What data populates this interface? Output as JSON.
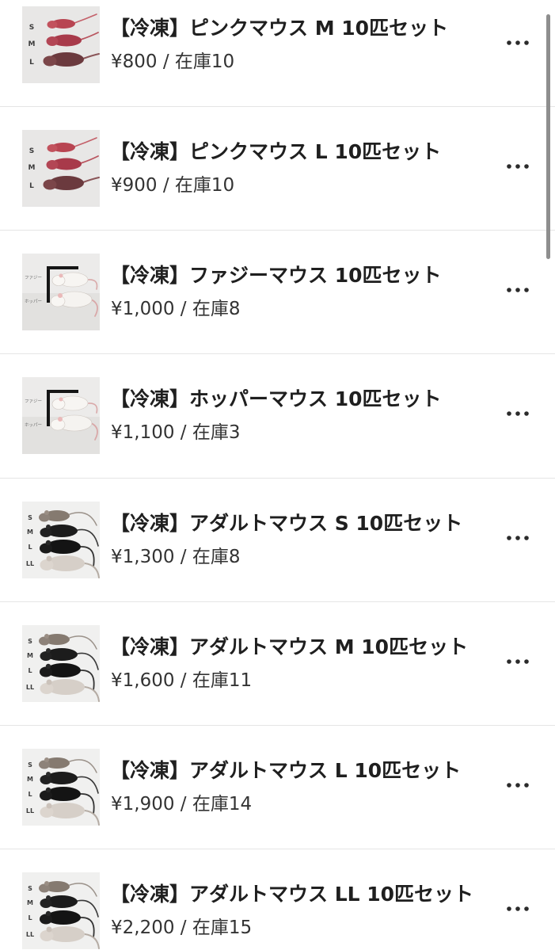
{
  "separator": " / ",
  "icons": {
    "row_menu_icon": "more-horizontal-icon"
  },
  "colors": {
    "background": "#ffffff",
    "title_text": "#1f1f1f",
    "price_text": "#333333",
    "divider": "#e5e5e5",
    "menu_icon": "#2b2b2b",
    "scrollbar": "#8e8e8e"
  },
  "products": [
    {
      "title": "【冷凍】ピンクマウス M 10匹セット",
      "price": "¥800",
      "stock": "在庫10",
      "thumbnail": {
        "labels": [
          "S",
          "M",
          "L"
        ]
      }
    },
    {
      "title": "【冷凍】ピンクマウス L 10匹セット",
      "price": "¥900",
      "stock": "在庫10",
      "thumbnail": {
        "labels": [
          "S",
          "M",
          "L"
        ]
      }
    },
    {
      "title": "【冷凍】ファジーマウス 10匹セット",
      "price": "¥1,000",
      "stock": "在庫8",
      "thumbnail": {
        "labels": [
          "ファジー",
          "ホッパー"
        ]
      }
    },
    {
      "title": "【冷凍】ホッパーマウス 10匹セット",
      "price": "¥1,100",
      "stock": "在庫3",
      "thumbnail": {
        "labels": [
          "ファジー",
          "ホッパー"
        ]
      }
    },
    {
      "title": "【冷凍】アダルトマウス S 10匹セット",
      "price": "¥1,300",
      "stock": "在庫8",
      "thumbnail": {
        "labels": [
          "S",
          "M",
          "L",
          "LL"
        ]
      }
    },
    {
      "title": "【冷凍】アダルトマウス M 10匹セット",
      "price": "¥1,600",
      "stock": "在庫11",
      "thumbnail": {
        "labels": [
          "S",
          "M",
          "L",
          "LL"
        ]
      }
    },
    {
      "title": "【冷凍】アダルトマウス L 10匹セット",
      "price": "¥1,900",
      "stock": "在庫14",
      "thumbnail": {
        "labels": [
          "S",
          "M",
          "L",
          "LL"
        ]
      }
    },
    {
      "title": "【冷凍】アダルトマウス LL 10匹セット",
      "price": "¥2,200",
      "stock": "在庫15",
      "thumbnail": {
        "labels": [
          "S",
          "M",
          "L",
          "LL"
        ]
      }
    }
  ]
}
